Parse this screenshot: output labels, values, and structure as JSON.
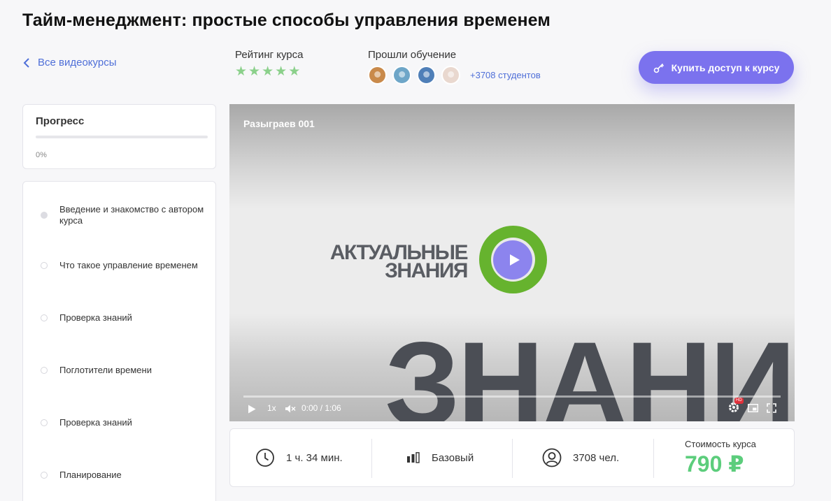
{
  "page": {
    "title": "Тайм-менеджмент: простые способы управления временем"
  },
  "nav": {
    "back_label": "Все видеокурсы"
  },
  "rating": {
    "label": "Рейтинг курса",
    "stars": 5,
    "star_glyph": "★",
    "color": "#8bd08b"
  },
  "students": {
    "label": "Прошли обучение",
    "count_label": "+3708 студентов",
    "avatars": [
      {
        "color": "#c98a4b"
      },
      {
        "color": "#6ea6c8"
      },
      {
        "color": "#4f7fb8"
      },
      {
        "color": "#e9d8cf"
      }
    ]
  },
  "buy": {
    "label": "Купить доступ к курсу",
    "icon": "key-icon",
    "color": "#7b72ee"
  },
  "progress": {
    "title": "Прогресс",
    "value": 0,
    "percent_label": "0%"
  },
  "lessons": [
    {
      "title": "Введение и знакомство с автором курса",
      "current": true
    },
    {
      "title": "Что такое управление временем",
      "current": false
    },
    {
      "title": "Проверка знаний",
      "current": false
    },
    {
      "title": "Поглотители времени",
      "current": false
    },
    {
      "title": "Проверка знаний",
      "current": false
    },
    {
      "title": "Планирование",
      "current": false
    }
  ],
  "video": {
    "title": "Разыграев 001",
    "logo_line1": "АКТУАЛЬНЫЕ",
    "logo_line2": "ЗНАНИЯ",
    "big_word": "ЗНАНИЯ",
    "speed": "1x",
    "time": "0:00 / 1:06",
    "quality_badge": "HD"
  },
  "course_info": {
    "duration": "1 ч. 34 мин.",
    "level": "Базовый",
    "participants": "3708 чел.",
    "price_label": "Стоимость курса",
    "price": "790 ₽",
    "price_color": "#5ccd7c"
  }
}
